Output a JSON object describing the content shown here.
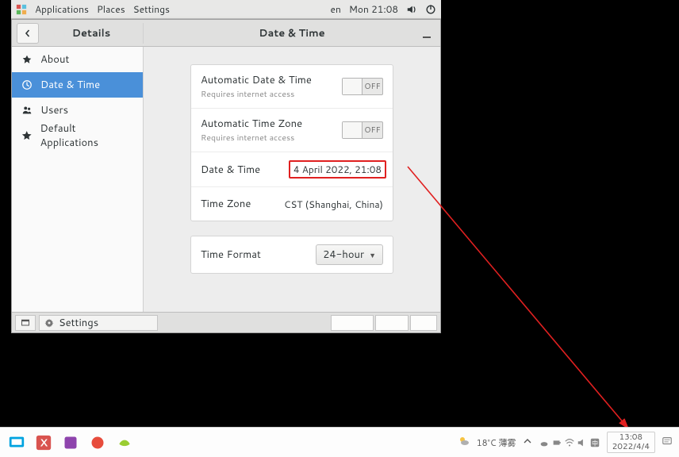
{
  "gnome_bar": {
    "apps": "Applications",
    "places": "Places",
    "settings": "Settings",
    "lang": "en",
    "clock": "Mon 21:08"
  },
  "window": {
    "left_title": "Details",
    "right_title": "Date & Time"
  },
  "sidebar": {
    "items": [
      {
        "label": "About",
        "icon": "about"
      },
      {
        "label": "Date & Time",
        "icon": "clock"
      },
      {
        "label": "Users",
        "icon": "users"
      },
      {
        "label": "Default Applications",
        "icon": "star"
      }
    ]
  },
  "settings": {
    "auto_dt": {
      "title": "Automatic Date & Time",
      "sub": "Requires internet access",
      "state": "OFF"
    },
    "auto_tz": {
      "title": "Automatic Time Zone",
      "sub": "Requires internet access",
      "state": "OFF"
    },
    "dt": {
      "title": "Date & Time",
      "value": "4 April 2022, 21:08"
    },
    "tz": {
      "title": "Time Zone",
      "value": "CST (Shanghai, China)"
    },
    "fmt": {
      "title": "Time Format",
      "value": "24-hour"
    }
  },
  "footer": {
    "task": "Settings"
  },
  "host": {
    "weather": "18°C 薄雾",
    "clock_time": "13:08",
    "clock_date": "2022/4/4"
  }
}
